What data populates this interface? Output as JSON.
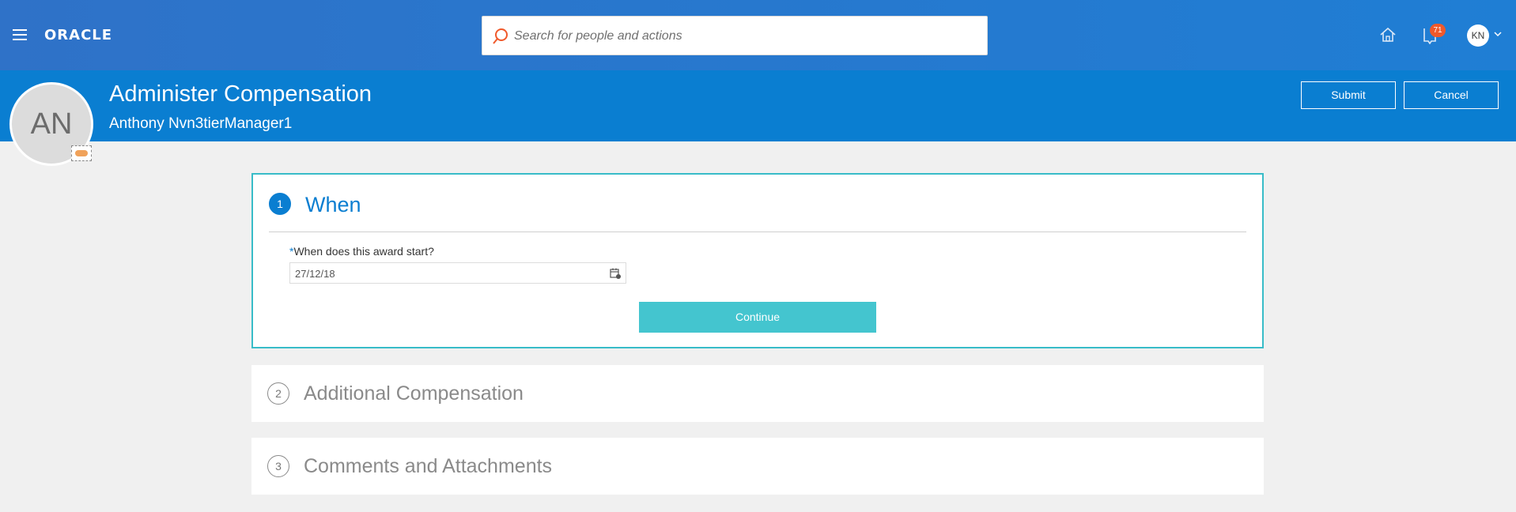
{
  "topbar": {
    "logo": "ORACLE",
    "search_placeholder": "Search for people and actions",
    "notification_count": "71",
    "user_initials": "KN"
  },
  "header": {
    "title": "Administer Compensation",
    "person_name": "Anthony Nvn3tierManager1",
    "avatar_initials": "AN",
    "submit_label": "Submit",
    "cancel_label": "Cancel"
  },
  "steps": [
    {
      "number": "1",
      "title": "When",
      "field_label": "When does this award start?",
      "required_marker": "*",
      "date_value": "27/12/18",
      "continue_label": "Continue"
    },
    {
      "number": "2",
      "title": "Additional Compensation"
    },
    {
      "number": "3",
      "title": "Comments and Attachments"
    }
  ],
  "colors": {
    "brand_blue": "#0a7ed1",
    "active_border": "#38bcc8",
    "continue_button": "#44c5cf",
    "badge": "#f0592b"
  }
}
